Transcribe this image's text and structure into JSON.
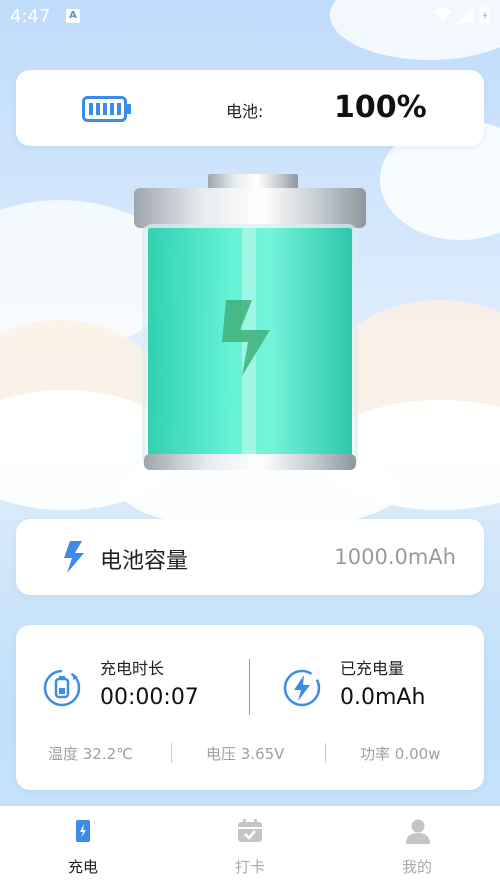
{
  "status_bar": {
    "time": "4:47",
    "notification_letter": "A"
  },
  "battery": {
    "label": "电池:",
    "percent": "100%"
  },
  "capacity": {
    "label": "电池容量",
    "value": "1000.0mAh"
  },
  "stats": {
    "charge_time_label": "充电时长",
    "charge_time_value": "00:00:07",
    "charged_label": "已充电量",
    "charged_value": "0.0mAh",
    "temperature": "温度 32.2℃",
    "voltage": "电压 3.65V",
    "power": "功率 0.00w"
  },
  "tabs": [
    {
      "label": "充电",
      "icon": "charging-icon",
      "active": true
    },
    {
      "label": "打卡",
      "icon": "calendar-check-icon",
      "active": false
    },
    {
      "label": "我的",
      "icon": "user-icon",
      "active": false
    }
  ],
  "colors": {
    "accent": "#3d8be8",
    "battery_liquid": "#3fe6c2",
    "bolt": "#40b07a"
  }
}
